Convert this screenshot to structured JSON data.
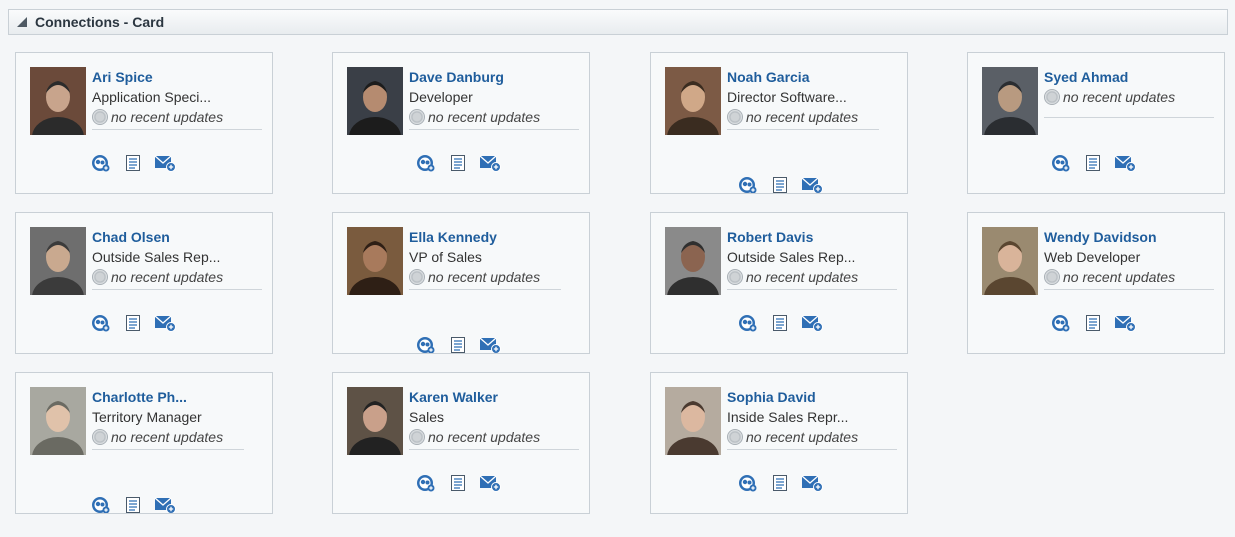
{
  "panel": {
    "title": "Connections - Card"
  },
  "status_text": "no recent updates",
  "people": [
    {
      "name": "Ari Spice",
      "title": "Application Speci...",
      "status": "no recent updates"
    },
    {
      "name": "Dave Danburg",
      "title": "Developer",
      "status": "no recent updates"
    },
    {
      "name": "Noah Garcia",
      "title": "Director Software...",
      "status": "no recent updates"
    },
    {
      "name": "Syed Ahmad",
      "title": "",
      "status": "no recent updates"
    },
    {
      "name": "Chad Olsen",
      "title": "Outside Sales Rep...",
      "status": "no recent updates"
    },
    {
      "name": "Ella Kennedy",
      "title": "VP of Sales",
      "status": "no recent updates"
    },
    {
      "name": "Robert Davis",
      "title": "Outside Sales Rep...",
      "status": "no recent updates"
    },
    {
      "name": "Wendy Davidson",
      "title": "Web Developer",
      "status": "no recent updates"
    },
    {
      "name": "Charlotte Ph...",
      "title": "Territory Manager",
      "status": "no recent updates"
    },
    {
      "name": "Karen Walker",
      "title": "Sales",
      "status": "no recent updates"
    },
    {
      "name": "Sophia David",
      "title": "Inside Sales Repr...",
      "status": "no recent updates"
    }
  ],
  "icons": {
    "connect": "add-connection-icon",
    "profile": "profile-document-icon",
    "message": "send-message-icon",
    "status": "presence-status-icon",
    "collapse": "collapse-triangle-icon"
  },
  "colors": {
    "link": "#1f5d9c",
    "icon_blue": "#2f6fb5",
    "border": "#c9d0d6",
    "card_bg": "#f7f9fa"
  }
}
